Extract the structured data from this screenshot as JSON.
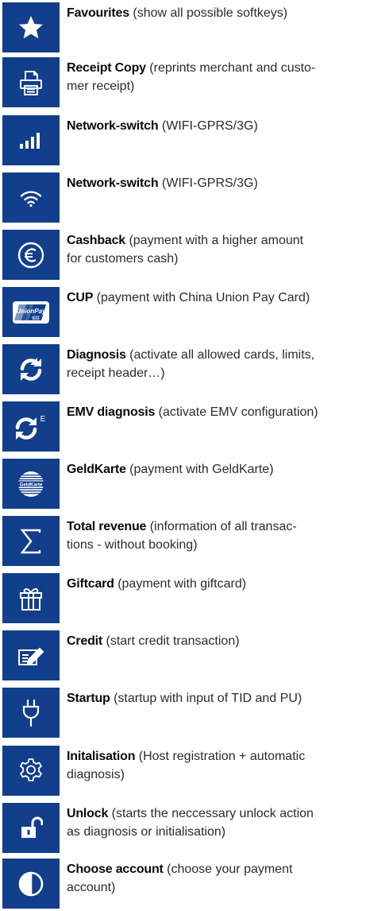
{
  "items": [
    {
      "icon": "star-icon",
      "term": "Favourites",
      "lines": [
        "(show all possible softkeys)"
      ]
    },
    {
      "icon": "printer-icon",
      "term": "Receipt Copy",
      "lines": [
        "(reprints merchant and custo-",
        "mer receipt)"
      ]
    },
    {
      "icon": "signal-bars-icon",
      "term": "Network-switch",
      "lines": [
        "(WIFI-GPRS/3G)"
      ]
    },
    {
      "icon": "wifi-icon",
      "term": "Network-switch",
      "lines": [
        "(WIFI-GPRS/3G)"
      ]
    },
    {
      "icon": "euro-icon",
      "term": "Cashback",
      "lines": [
        "(payment with a higher amount",
        "for customers cash)"
      ]
    },
    {
      "icon": "unionpay-card-icon",
      "term": "CUP",
      "lines": [
        "(payment with China Union Pay Card)"
      ],
      "icon_text": "UnionPay",
      "icon_subtext": "银联"
    },
    {
      "icon": "refresh-icon",
      "term": "Diagnosis",
      "lines": [
        "(activate all allowed cards, limits,",
        "receipt header…)"
      ]
    },
    {
      "icon": "refresh-e-icon",
      "term": "EMV diagnosis",
      "lines": [
        "(activate EMV configuration)"
      ],
      "icon_text": "E"
    },
    {
      "icon": "geldkarte-icon",
      "term": "GeldKarte",
      "lines": [
        "(payment with GeldKarte)"
      ],
      "icon_text": "GeldKarte"
    },
    {
      "icon": "sigma-icon",
      "term": "Total revenue",
      "lines": [
        "(information of all transac-",
        "tions  -  without booking)"
      ]
    },
    {
      "icon": "gift-icon",
      "term": "Giftcard",
      "lines": [
        "(payment with giftcard)"
      ]
    },
    {
      "icon": "edit-icon",
      "term": "Credit",
      "lines": [
        "(start credit transaction)"
      ]
    },
    {
      "icon": "plug-icon",
      "term": "Startup",
      "lines": [
        "(startup with input of TID and PU)"
      ]
    },
    {
      "icon": "gear-icon",
      "term": "Initalisation",
      "lines": [
        "(Host registration + automatic",
        "diagnosis)"
      ]
    },
    {
      "icon": "unlock-icon",
      "term": "Unlock",
      "lines": [
        "(starts the neccessary unlock action",
        "as diagnosis or initialisation)"
      ]
    },
    {
      "icon": "half-circle-icon",
      "term": "Choose account",
      "lines": [
        "(choose your payment",
        "account)"
      ]
    }
  ],
  "colors": {
    "tile": "#123f8c",
    "icon": "#ffffff"
  }
}
